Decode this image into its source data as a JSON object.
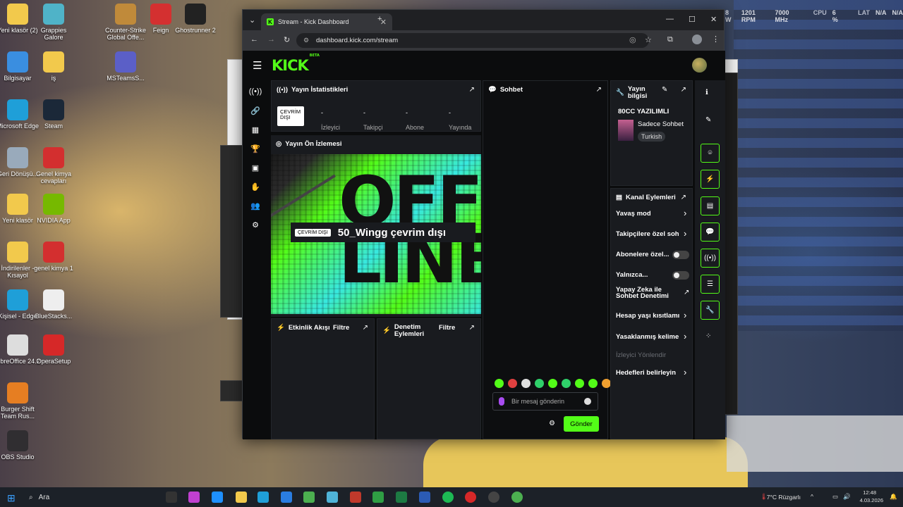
{
  "desktop_icons": [
    {
      "label": "Yeni klasör (2)",
      "color": "#f2c94c"
    },
    {
      "label": "Grappies Galore",
      "color": "#4fb3c8"
    },
    {
      "label": "Counter-Strike Global Offe...",
      "color": "#c08a3a"
    },
    {
      "label": "Feign",
      "color": "#d43030"
    },
    {
      "label": "Ghostrunner 2",
      "color": "#222"
    },
    {
      "label": "Bilgisayar",
      "color": "#3a8ee0"
    },
    {
      "label": "iş",
      "color": "#f2c94c"
    },
    {
      "label": "MSTeamsS...",
      "color": "#5b5fc7"
    },
    {
      "label": "Microsoft Edge",
      "color": "#1f9fd8"
    },
    {
      "label": "Steam",
      "color": "#1b2838"
    },
    {
      "label": "Geri Dönüşü...",
      "color": "#9ab"
    },
    {
      "label": "Genel kimya cevapları",
      "color": "#d32f2f"
    },
    {
      "label": "Yeni klasör",
      "color": "#f2c94c"
    },
    {
      "label": "NVIDIA App",
      "color": "#76b900"
    },
    {
      "label": "İndirilenler - Kısayol",
      "color": "#f2c94c"
    },
    {
      "label": "genel kimya 1",
      "color": "#d32f2f"
    },
    {
      "label": "Kişisel - Edge",
      "color": "#1f9fd8"
    },
    {
      "label": "BlueStacks...",
      "color": "#eee"
    },
    {
      "label": "LibreOffice 24.2",
      "color": "#ddd"
    },
    {
      "label": "OperaSetup",
      "color": "#d62828"
    },
    {
      "label": "Burger Shift Team Rus...",
      "color": "#e67e22"
    },
    {
      "label": "OBS Studio",
      "color": "#302e31"
    }
  ],
  "hwinfo": {
    "w": "8 W",
    "rpm": "1201 RPM",
    "mhz": "7000 MHz",
    "cpu_label": "CPU",
    "cpu": "6 %",
    "lat_label": "LAT",
    "lat1": "N/A",
    "lat2": "N/A"
  },
  "browser": {
    "tab_title": "Stream - Kick Dashboard",
    "tab_close": "✕",
    "new_tab": "+",
    "url": "dashboard.kick.com/stream",
    "win_min": "—",
    "win_max": "☐",
    "win_close": "✕"
  },
  "kick": {
    "logo": "KICK",
    "logo_beta": "BETA",
    "stats": {
      "title": "Yayın İstatistikleri",
      "badge": "ÇEVRİM DIŞI",
      "items": [
        {
          "value": "-",
          "label": "İzleyici"
        },
        {
          "value": "-",
          "label": "Takipçi"
        },
        {
          "value": "-",
          "label": "Abone"
        },
        {
          "value": "-",
          "label": "Yayında"
        }
      ]
    },
    "preview": {
      "title": "Yayın Ön İzlemesi",
      "big_text": "OFF LINE",
      "badge": "ÇEVRİM DIŞI",
      "offline_text": "50_Wingg çevrim dışı"
    },
    "activity": {
      "title": "Etkinlik Akışı",
      "filter": "Filtre"
    },
    "moderation": {
      "title": "Denetim Eylemleri",
      "filter": "Filtre"
    },
    "chat": {
      "title": "Sohbet",
      "placeholder": "Bir mesaj gönderin",
      "send": "Gönder"
    },
    "info": {
      "title": "Yayın bilgisi",
      "stream_title": "80CC YAZILIMLI",
      "category": "Sadece Sohbet",
      "language": "Turkish"
    },
    "actions": {
      "title": "Kanal Eylemleri",
      "items": [
        {
          "label": "Yavaş mod",
          "kind": "chev"
        },
        {
          "label": "Takipçilere özel soh",
          "kind": "chev"
        },
        {
          "label": "Abonelere özel...",
          "kind": "toggle"
        },
        {
          "label": "Yalnızca...",
          "kind": "toggle"
        },
        {
          "label": "Yapay Zeka ile Sohbet Denetimi",
          "kind": "ext"
        },
        {
          "label": "Hesap yaşı kısıtlamı",
          "kind": "chev"
        },
        {
          "label": "Yasaklanmış kelime",
          "kind": "chev"
        },
        {
          "label": "İzleyici Yönlendir",
          "kind": "disabled"
        },
        {
          "label": "Hedefleri belirleyin",
          "kind": "chev"
        }
      ]
    }
  },
  "taskbar": {
    "search": "Ara",
    "weather": "7°C Rüzgarlı",
    "time": "12:48",
    "date": "4.03.2026"
  },
  "colors": {
    "kick_green": "#53fc18",
    "panel": "#191b1f",
    "page": "#0b0c0d"
  }
}
